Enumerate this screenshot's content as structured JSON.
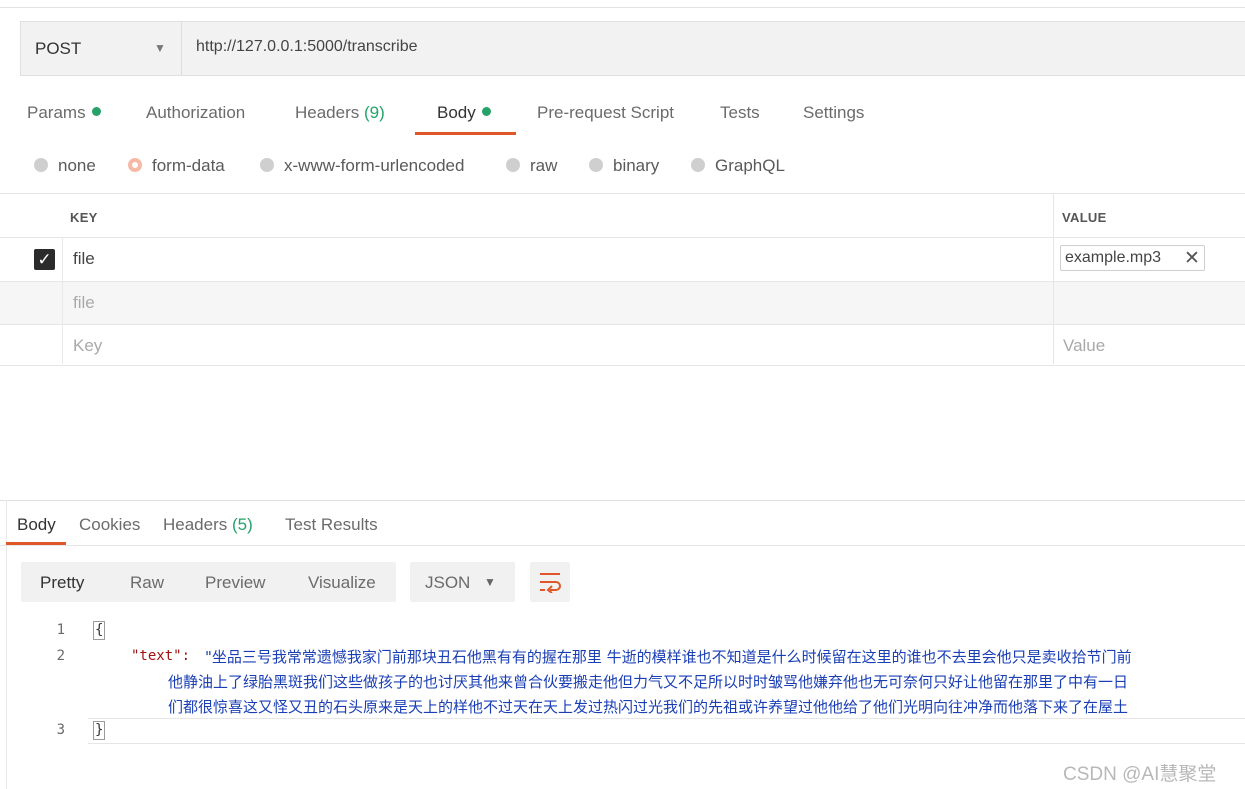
{
  "request": {
    "method": "POST",
    "url": "http://127.0.0.1:5000/transcribe",
    "tabs": [
      {
        "label": "Params",
        "dot": true
      },
      {
        "label": "Authorization"
      },
      {
        "label": "Headers",
        "count": "(9)"
      },
      {
        "label": "Body",
        "dot": true,
        "active": true
      },
      {
        "label": "Pre-request Script"
      },
      {
        "label": "Tests"
      },
      {
        "label": "Settings"
      }
    ],
    "body_types": [
      "none",
      "form-data",
      "x-www-form-urlencoded",
      "raw",
      "binary",
      "GraphQL"
    ],
    "selected_body_type": "form-data",
    "table": {
      "key_header": "KEY",
      "value_header": "VALUE",
      "rows": [
        {
          "key": "file",
          "value": "example.mp3",
          "checked": true
        },
        {
          "key": "file",
          "value": ""
        }
      ],
      "key_placeholder": "Key",
      "value_placeholder": "Value"
    }
  },
  "response": {
    "tabs": [
      {
        "label": "Body",
        "active": true
      },
      {
        "label": "Cookies"
      },
      {
        "label": "Headers",
        "count": "(5)"
      },
      {
        "label": "Test Results"
      }
    ],
    "view_modes": [
      "Pretty",
      "Raw",
      "Preview",
      "Visualize"
    ],
    "active_view": "Pretty",
    "format": "JSON",
    "wrap_icon": "wrap-lines-icon",
    "code": {
      "line_numbers": [
        "1",
        "2",
        "3"
      ],
      "open_brace": "{",
      "close_brace": "}",
      "key": "\"text\":",
      "value_lines": [
        "\"坐品三号我常常遗憾我家门前那块丑石他黑有有的握在那里 牛逝的模样谁也不知道是什么时候留在这里的谁也不去里会他只是卖收拾节门前",
        "他静油上了绿胎黑斑我们这些做孩子的也讨厌其他来曾合伙要搬走他但力气又不足所以时时皱骂他嫌弃他也无可奈何只好让他留在那里了中有一日",
        "们都很惊喜这又怪又丑的石头原来是天上的样他不过天在天上发过热闪过光我们的先祖或许养望过他他给了他们光明向往冲净而他落下来了在屋土"
      ]
    }
  },
  "watermark": "CSDN @AI慧聚堂",
  "colors": {
    "accent": "#e0572a",
    "status_green": "#26a269",
    "json_key": "#a01010",
    "json_string": "#1a3fb5"
  }
}
